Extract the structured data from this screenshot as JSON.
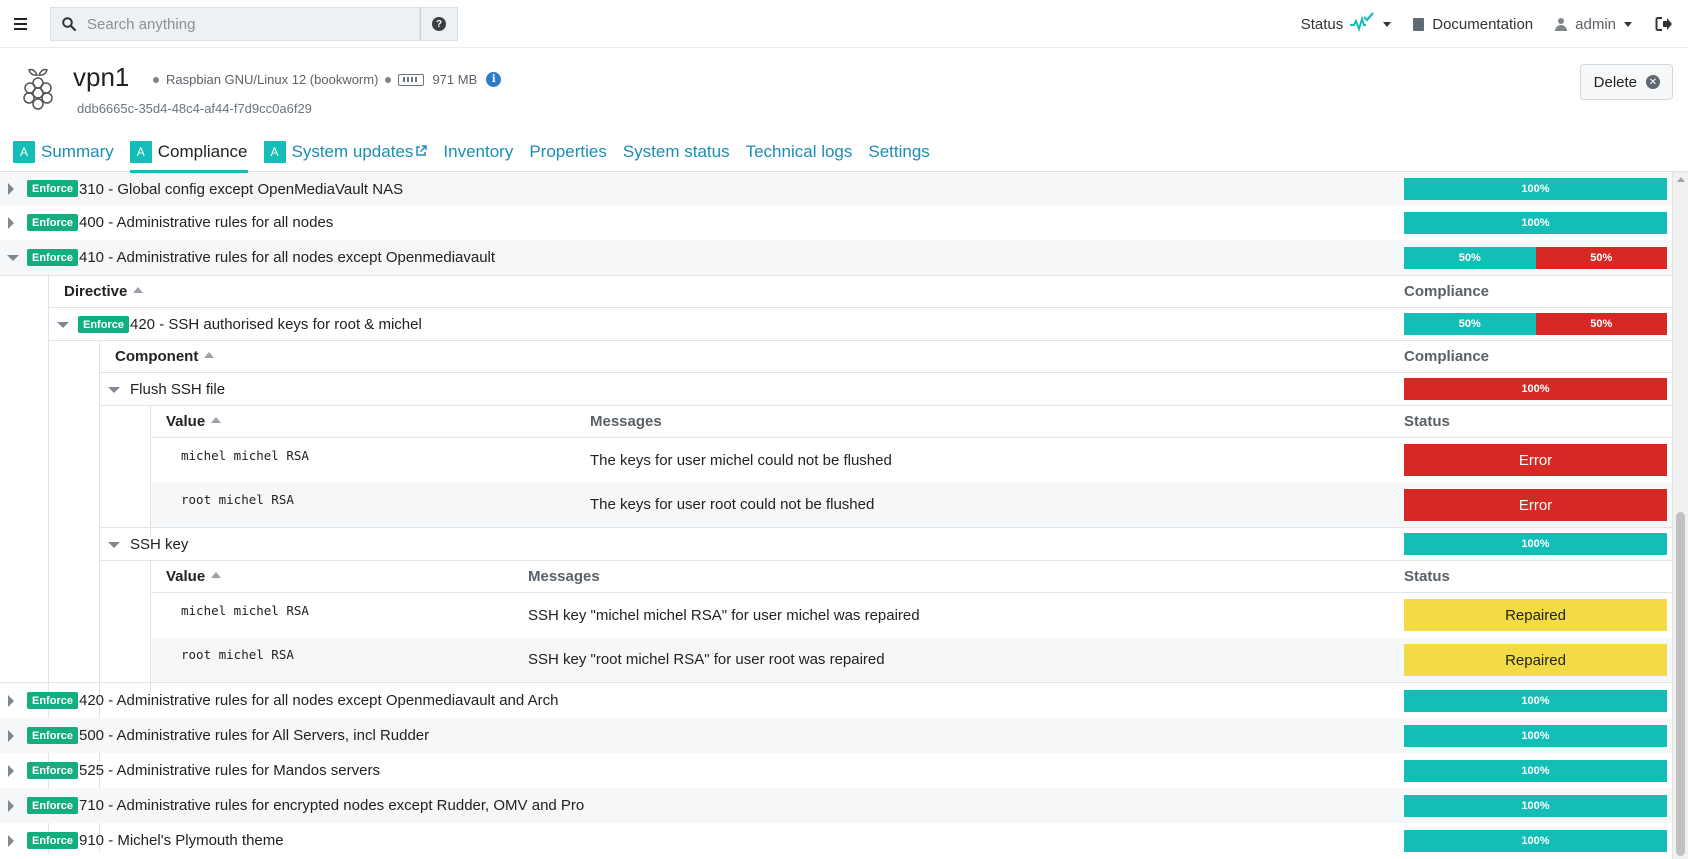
{
  "topbar": {
    "search_placeholder": "Search anything",
    "help_icon": "?",
    "status_label": "Status",
    "documentation_label": "Documentation",
    "user_label": "admin"
  },
  "node": {
    "name": "vpn1",
    "os": "Raspbian GNU/Linux 12 (bookworm)",
    "ram": "971 MB",
    "id": "ddb6665c-35d4-48c4-af44-f7d9cc0a6f29",
    "delete_label": "Delete"
  },
  "tabs": [
    {
      "label": "Summary",
      "badge": "A"
    },
    {
      "label": "Compliance",
      "badge": "A"
    },
    {
      "label": "System updates",
      "badge": "A"
    },
    {
      "label": "Inventory"
    },
    {
      "label": "Properties"
    },
    {
      "label": "System status"
    },
    {
      "label": "Technical logs"
    },
    {
      "label": "Settings"
    }
  ],
  "enforce_label": "Enforce",
  "rules_top": [
    {
      "name": "310 - Global config except OpenMediaVault NAS",
      "compliance": [
        {
          "label": "100%",
          "pct": 100,
          "kind": "ok"
        }
      ]
    },
    {
      "name": "400 - Administrative rules for all nodes",
      "compliance": [
        {
          "label": "100%",
          "pct": 100,
          "kind": "ok"
        }
      ]
    },
    {
      "name": "410 - Administrative rules for all nodes except Openmediavault",
      "compliance": [
        {
          "label": "50%",
          "pct": 50,
          "kind": "ok"
        },
        {
          "label": "50%",
          "pct": 50,
          "kind": "err"
        }
      ]
    }
  ],
  "directive_table": {
    "header_name": "Directive",
    "header_compliance": "Compliance",
    "directive": {
      "name": "420 - SSH authorised keys for root & michel",
      "compliance": [
        {
          "label": "50%",
          "pct": 50,
          "kind": "ok"
        },
        {
          "label": "50%",
          "pct": 50,
          "kind": "err"
        }
      ]
    },
    "component_header": "Component",
    "component_compliance_header": "Compliance",
    "components": [
      {
        "name": "Flush SSH file",
        "compliance": [
          {
            "label": "100%",
            "pct": 100,
            "kind": "err"
          }
        ],
        "value_header": "Value",
        "messages_header": "Messages",
        "status_header": "Status",
        "values": [
          {
            "value": "michel michel RSA",
            "message": "The keys for user michel could not be flushed",
            "status": "Error"
          },
          {
            "value": "root michel RSA",
            "message": "The keys for user root could not be flushed",
            "status": "Error"
          }
        ]
      },
      {
        "name": "SSH key",
        "compliance": [
          {
            "label": "100%",
            "pct": 100,
            "kind": "ok"
          }
        ],
        "value_header": "Value",
        "messages_header": "Messages",
        "status_header": "Status",
        "values": [
          {
            "value": "michel michel RSA",
            "message": "SSH key \"michel michel RSA\" for user michel was repaired",
            "status": "Repaired"
          },
          {
            "value": "root michel RSA",
            "message": "SSH key \"root michel RSA\" for user root was repaired",
            "status": "Repaired"
          }
        ]
      }
    ]
  },
  "rules_bottom": [
    {
      "name": "420 - Administrative rules for all nodes except Openmediavault and Arch",
      "compliance": [
        {
          "label": "100%",
          "pct": 100,
          "kind": "ok"
        }
      ]
    },
    {
      "name": "500 - Administrative rules for All Servers, incl Rudder",
      "compliance": [
        {
          "label": "100%",
          "pct": 100,
          "kind": "ok"
        }
      ]
    },
    {
      "name": "525 - Administrative rules for Mandos servers",
      "compliance": [
        {
          "label": "100%",
          "pct": 100,
          "kind": "ok"
        }
      ]
    },
    {
      "name": "710 - Administrative rules for encrypted nodes except Rudder, OMV and Pro",
      "compliance": [
        {
          "label": "100%",
          "pct": 100,
          "kind": "ok"
        }
      ]
    },
    {
      "name": "910 - Michel's Plymouth theme",
      "compliance": [
        {
          "label": "100%",
          "pct": 100,
          "kind": "ok"
        }
      ]
    }
  ]
}
